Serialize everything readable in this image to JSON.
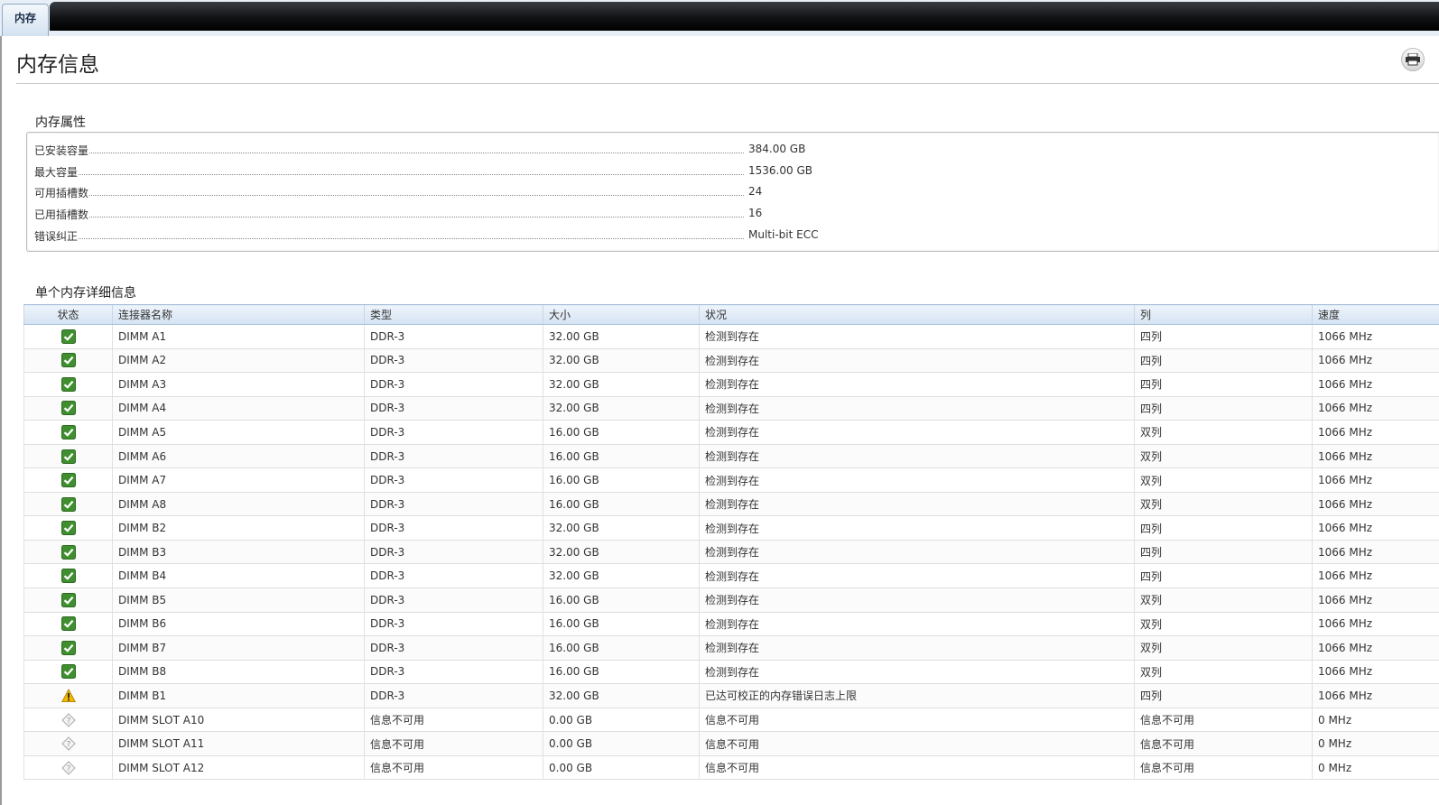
{
  "tab": {
    "label": "内存"
  },
  "page": {
    "title": "内存信息"
  },
  "properties": {
    "heading": "内存属性",
    "items": [
      {
        "label": "已安装容量",
        "value": "384.00 GB"
      },
      {
        "label": "最大容量",
        "value": "1536.00 GB"
      },
      {
        "label": "可用插槽数",
        "value": "24"
      },
      {
        "label": "已用插槽数",
        "value": "16"
      },
      {
        "label": "错误纠正",
        "value": "Multi-bit ECC"
      }
    ]
  },
  "details": {
    "heading": "单个内存详细信息",
    "columns": [
      "状态",
      "连接器名称",
      "类型",
      "大小",
      "状况",
      "列",
      "速度"
    ],
    "rows": [
      {
        "status": "ok",
        "name": "DIMM A1",
        "type": "DDR-3",
        "size": "32.00 GB",
        "condition": "检测到存在",
        "rank": "四列",
        "speed": "1066 MHz"
      },
      {
        "status": "ok",
        "name": "DIMM A2",
        "type": "DDR-3",
        "size": "32.00 GB",
        "condition": "检测到存在",
        "rank": "四列",
        "speed": "1066 MHz"
      },
      {
        "status": "ok",
        "name": "DIMM A3",
        "type": "DDR-3",
        "size": "32.00 GB",
        "condition": "检测到存在",
        "rank": "四列",
        "speed": "1066 MHz"
      },
      {
        "status": "ok",
        "name": "DIMM A4",
        "type": "DDR-3",
        "size": "32.00 GB",
        "condition": "检测到存在",
        "rank": "四列",
        "speed": "1066 MHz"
      },
      {
        "status": "ok",
        "name": "DIMM A5",
        "type": "DDR-3",
        "size": "16.00 GB",
        "condition": "检测到存在",
        "rank": "双列",
        "speed": "1066 MHz"
      },
      {
        "status": "ok",
        "name": "DIMM A6",
        "type": "DDR-3",
        "size": "16.00 GB",
        "condition": "检测到存在",
        "rank": "双列",
        "speed": "1066 MHz"
      },
      {
        "status": "ok",
        "name": "DIMM A7",
        "type": "DDR-3",
        "size": "16.00 GB",
        "condition": "检测到存在",
        "rank": "双列",
        "speed": "1066 MHz"
      },
      {
        "status": "ok",
        "name": "DIMM A8",
        "type": "DDR-3",
        "size": "16.00 GB",
        "condition": "检测到存在",
        "rank": "双列",
        "speed": "1066 MHz"
      },
      {
        "status": "ok",
        "name": "DIMM B2",
        "type": "DDR-3",
        "size": "32.00 GB",
        "condition": "检测到存在",
        "rank": "四列",
        "speed": "1066 MHz"
      },
      {
        "status": "ok",
        "name": "DIMM B3",
        "type": "DDR-3",
        "size": "32.00 GB",
        "condition": "检测到存在",
        "rank": "四列",
        "speed": "1066 MHz"
      },
      {
        "status": "ok",
        "name": "DIMM B4",
        "type": "DDR-3",
        "size": "32.00 GB",
        "condition": "检测到存在",
        "rank": "四列",
        "speed": "1066 MHz"
      },
      {
        "status": "ok",
        "name": "DIMM B5",
        "type": "DDR-3",
        "size": "16.00 GB",
        "condition": "检测到存在",
        "rank": "双列",
        "speed": "1066 MHz"
      },
      {
        "status": "ok",
        "name": "DIMM B6",
        "type": "DDR-3",
        "size": "16.00 GB",
        "condition": "检测到存在",
        "rank": "双列",
        "speed": "1066 MHz"
      },
      {
        "status": "ok",
        "name": "DIMM B7",
        "type": "DDR-3",
        "size": "16.00 GB",
        "condition": "检测到存在",
        "rank": "双列",
        "speed": "1066 MHz"
      },
      {
        "status": "ok",
        "name": "DIMM B8",
        "type": "DDR-3",
        "size": "16.00 GB",
        "condition": "检测到存在",
        "rank": "双列",
        "speed": "1066 MHz"
      },
      {
        "status": "warning",
        "name": "DIMM B1",
        "type": "DDR-3",
        "size": "32.00 GB",
        "condition": "已达可校正的内存错误日志上限",
        "rank": "四列",
        "speed": "1066 MHz"
      },
      {
        "status": "unknown",
        "name": "DIMM SLOT A10",
        "type": "信息不可用",
        "size": "0.00 GB",
        "condition": "信息不可用",
        "rank": "信息不可用",
        "speed": "0 MHz"
      },
      {
        "status": "unknown",
        "name": "DIMM SLOT A11",
        "type": "信息不可用",
        "size": "0.00 GB",
        "condition": "信息不可用",
        "rank": "信息不可用",
        "speed": "0 MHz"
      },
      {
        "status": "unknown",
        "name": "DIMM SLOT A12",
        "type": "信息不可用",
        "size": "0.00 GB",
        "condition": "信息不可用",
        "rank": "信息不可用",
        "speed": "0 MHz"
      }
    ]
  },
  "icons": {
    "ok": "check-icon",
    "warning": "warning-icon",
    "unknown": "unknown-icon",
    "print": "print-icon"
  },
  "colors": {
    "ok": "#3f8f2f",
    "warning": "#f2b800",
    "tabbar": "#111215",
    "header": "#d5e3f2"
  }
}
